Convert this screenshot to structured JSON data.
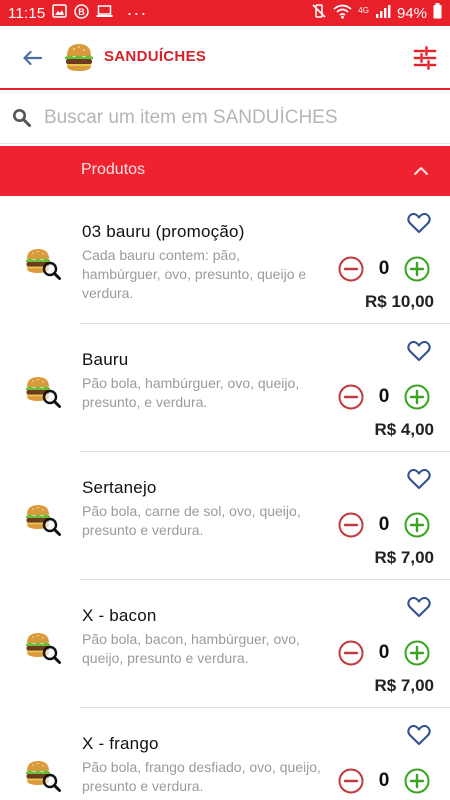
{
  "status_bar": {
    "time": "11:15",
    "more": "···",
    "network": "4G",
    "battery": "94%",
    "colors": {
      "background": "#e8202a"
    }
  },
  "header": {
    "title": "SANDUÍCHES",
    "back_icon": "back-arrow-icon",
    "filter_icon": "filter-sliders-icon",
    "colors": {
      "title": "#d8222b",
      "accent": "#e8202a"
    }
  },
  "search": {
    "placeholder": "Buscar um item em SANDUÍCHES",
    "value": ""
  },
  "category": {
    "label": "Produtos",
    "expanded": true,
    "colors": {
      "background": "#ef2330"
    }
  },
  "products": [
    {
      "name": "03 bauru (promoção)",
      "description": "Cada bauru contem: pão, hambúrguer, ovo, presunto, queijo e verdura.",
      "quantity": "0",
      "price": "R$ 10,00"
    },
    {
      "name": "Bauru",
      "description": "Pão bola, hambúrguer, ovo, queijo, presunto, e verdura.",
      "quantity": "0",
      "price": "R$ 4,00"
    },
    {
      "name": "Sertanejo",
      "description": "Pão bola, carne de sol, ovo, queijo, presunto e verdura.",
      "quantity": "0",
      "price": "R$ 7,00"
    },
    {
      "name": "X - bacon",
      "description": "Pão bola, bacon, hambúrguer, ovo, queijo, presunto e verdura.",
      "quantity": "0",
      "price": "R$ 7,00"
    },
    {
      "name": "X - frango",
      "description": "Pão bola, frango desfiado, ovo, queijo, presunto e verdura.",
      "quantity": "0",
      "price": ""
    }
  ],
  "colors": {
    "minus": "#c0393f",
    "plus": "#3aa320",
    "heart": "#2d4f8c"
  }
}
